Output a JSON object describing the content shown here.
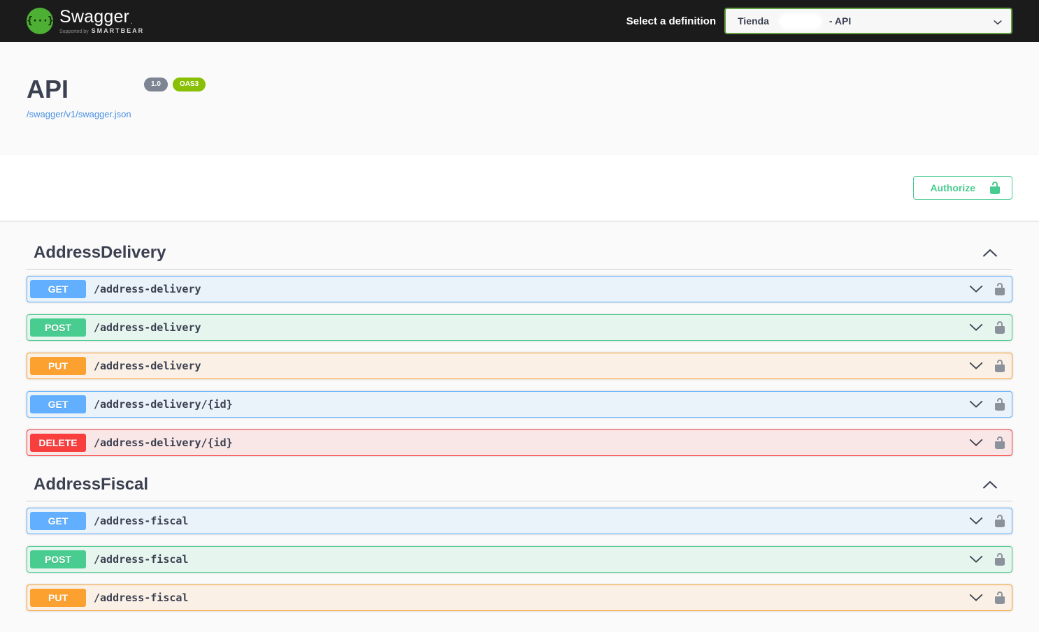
{
  "topbar": {
    "logo_text": "Swagger",
    "logo_mark": ".",
    "tagline_prefix": "Supported by",
    "tagline_brand": "SMARTBEAR",
    "select_label": "Select a definition",
    "select_value_prefix": "Tienda",
    "select_value_suffix": "- API"
  },
  "info": {
    "title": "API",
    "version_badge": "1.0",
    "oas_badge": "OAS3",
    "spec_link": "/swagger/v1/swagger.json"
  },
  "auth": {
    "authorize_label": "Authorize"
  },
  "icons": {
    "logo_braces": "{···}"
  },
  "colors": {
    "topbar_bg": "#1b1b1b",
    "page_bg": "#fafafa",
    "text": "#3b4151",
    "link_blue": "#4990e2",
    "auth_green": "#49cc90",
    "logo_green": "#4daf33",
    "select_border": "#62a03f",
    "version_badge_bg": "#7d8492",
    "oas_badge_bg": "#89bf04",
    "lock_gray": "#8c929c",
    "method_colors": {
      "GET": "#61affe",
      "POST": "#49cc90",
      "PUT": "#fca130",
      "DELETE": "#f93e3e"
    }
  },
  "sections": [
    {
      "title": "AddressDelivery",
      "expanded": true,
      "operations": [
        {
          "method": "GET",
          "path": "/address-delivery"
        },
        {
          "method": "POST",
          "path": "/address-delivery"
        },
        {
          "method": "PUT",
          "path": "/address-delivery"
        },
        {
          "method": "GET",
          "path": "/address-delivery/{id}"
        },
        {
          "method": "DELETE",
          "path": "/address-delivery/{id}"
        }
      ]
    },
    {
      "title": "AddressFiscal",
      "expanded": true,
      "operations": [
        {
          "method": "GET",
          "path": "/address-fiscal"
        },
        {
          "method": "POST",
          "path": "/address-fiscal"
        },
        {
          "method": "PUT",
          "path": "/address-fiscal"
        }
      ]
    }
  ]
}
